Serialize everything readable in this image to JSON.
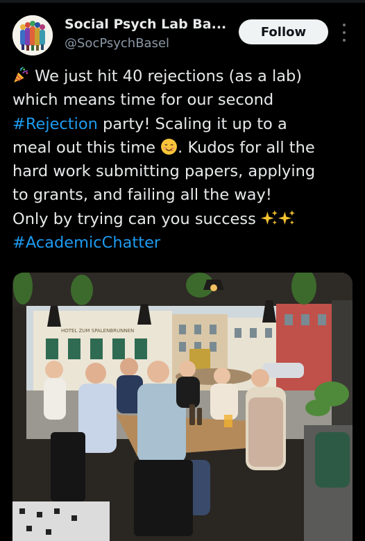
{
  "author": {
    "display_name": "Social Psych Lab Ba...",
    "handle": "@SocPsychBasel",
    "avatar_icon": "lab-logo-avatar"
  },
  "follow_label": "Follow",
  "more_icon": "more-options-icon",
  "tweet": {
    "line1": "We just hit 40 rejections (as a lab)",
    "line2": "which means time for our second",
    "line3_hashtag": "#Rejection",
    "line3_rest": " party! Scaling it up to a",
    "line4_a": "meal out this time ",
    "line4_b": ". Kudos for all the",
    "line5": "hard work submitting papers, applying",
    "line6": "to grants, and failing all the way!",
    "line7": "Only by trying can you success ",
    "line8_hashtag": "#AcademicChatter",
    "emojis": [
      "party-popper-icon",
      "smiling-face-icon",
      "sparkles-icon",
      "sparkles-icon"
    ]
  },
  "photo": {
    "sign_text": "HOTEL ZUM SPALENBRUNNEN"
  },
  "colors": {
    "background": "#000000",
    "text": "#e7e9ea",
    "secondary": "#8b98a5",
    "link": "#1d9bf0",
    "follow_bg": "#eff3f4"
  }
}
